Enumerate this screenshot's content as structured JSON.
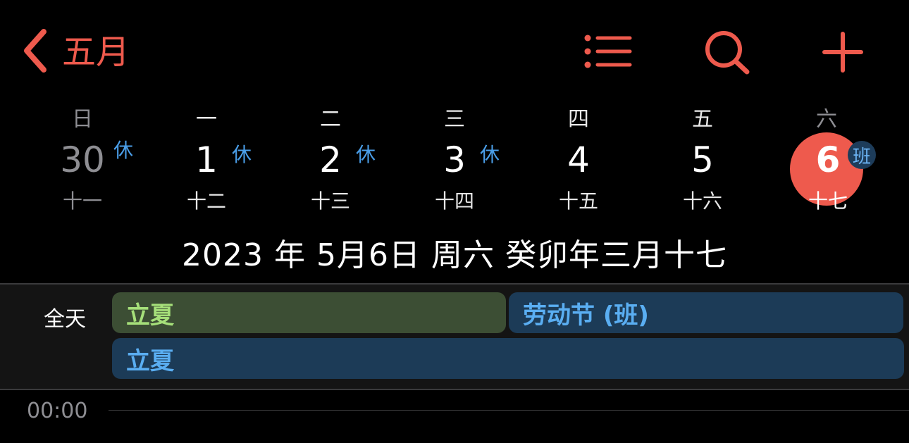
{
  "header": {
    "back_label": "五月",
    "icons": {
      "back": "chevron-left-icon",
      "list": "list-icon",
      "search": "search-icon",
      "add": "plus-icon"
    },
    "accent_color": "#ee5a4d"
  },
  "week": {
    "weekdays": [
      "日",
      "一",
      "二",
      "三",
      "四",
      "五",
      "六"
    ],
    "days": [
      {
        "num": "30",
        "lunar": "十一",
        "badge": "休"
      },
      {
        "num": "1",
        "lunar": "十二",
        "badge": "休"
      },
      {
        "num": "2",
        "lunar": "十三",
        "badge": "休"
      },
      {
        "num": "3",
        "lunar": "十四",
        "badge": "休"
      },
      {
        "num": "4",
        "lunar": "十五"
      },
      {
        "num": "5",
        "lunar": "十六"
      },
      {
        "num": "6",
        "lunar": "十七",
        "badge": "班"
      }
    ]
  },
  "selected_date": "2023 年 5月6日 周六   癸卯年三月十七",
  "allday": {
    "label": "全天",
    "events": [
      {
        "title": "立夏"
      },
      {
        "title": "劳动节 (班)"
      },
      {
        "title": "立夏"
      }
    ]
  },
  "timeline": {
    "first_hour": "00:00"
  }
}
